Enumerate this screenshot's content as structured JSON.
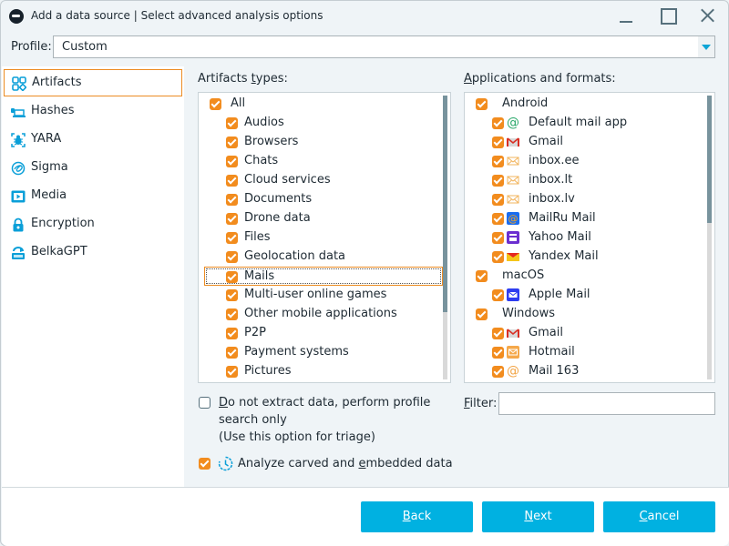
{
  "window": {
    "title": "Add a data source | Select advanced analysis options",
    "minimize_label": "minimize",
    "maximize_label": "maximize",
    "close_label": "close"
  },
  "profile": {
    "label": "Profile:",
    "value": "Custom"
  },
  "sidebar": {
    "items": [
      {
        "label": "Artifacts",
        "icon": "artifacts-icon",
        "active": true
      },
      {
        "label": "Hashes",
        "icon": "hashes-icon",
        "active": false
      },
      {
        "label": "YARA",
        "icon": "yara-bug-icon",
        "active": false
      },
      {
        "label": "Sigma",
        "icon": "sigma-icon",
        "active": false
      },
      {
        "label": "Media",
        "icon": "media-icon",
        "active": false
      },
      {
        "label": "Encryption",
        "icon": "lock-icon",
        "active": false
      },
      {
        "label": "BelkaGPT",
        "icon": "belkagpt-icon",
        "active": false
      }
    ]
  },
  "artifacts": {
    "label_pre": "Artifacts ",
    "label_u": "t",
    "label_post": "ypes:",
    "items": [
      {
        "label": "All",
        "checked": true,
        "level": 0
      },
      {
        "label": "Audios",
        "checked": true,
        "level": 1
      },
      {
        "label": "Browsers",
        "checked": true,
        "level": 1
      },
      {
        "label": "Chats",
        "checked": true,
        "level": 1
      },
      {
        "label": "Cloud services",
        "checked": true,
        "level": 1
      },
      {
        "label": "Documents",
        "checked": true,
        "level": 1
      },
      {
        "label": "Drone data",
        "checked": true,
        "level": 1
      },
      {
        "label": "Files",
        "checked": true,
        "level": 1
      },
      {
        "label": "Geolocation data",
        "checked": true,
        "level": 1
      },
      {
        "label": "Mails",
        "checked": true,
        "level": 1,
        "focused": true
      },
      {
        "label": "Multi-user online games",
        "checked": true,
        "level": 1
      },
      {
        "label": "Other mobile applications",
        "checked": true,
        "level": 1
      },
      {
        "label": "P2P",
        "checked": true,
        "level": 1
      },
      {
        "label": "Payment systems",
        "checked": true,
        "level": 1
      },
      {
        "label": "Pictures",
        "checked": true,
        "level": 1
      }
    ]
  },
  "applications": {
    "label_u": "A",
    "label_post": "pplications and formats:",
    "items": [
      {
        "label": "Android",
        "checked": true,
        "level": 0,
        "icon": ""
      },
      {
        "label": "Default mail app",
        "checked": true,
        "level": 1,
        "icon": "at-sign-green-icon"
      },
      {
        "label": "Gmail",
        "checked": true,
        "level": 1,
        "icon": "gmail-icon"
      },
      {
        "label": "inbox.ee",
        "checked": true,
        "level": 1,
        "icon": "envelope-outline-icon"
      },
      {
        "label": "inbox.lt",
        "checked": true,
        "level": 1,
        "icon": "envelope-outline-icon"
      },
      {
        "label": "inbox.lv",
        "checked": true,
        "level": 1,
        "icon": "envelope-outline-icon"
      },
      {
        "label": "MailRu Mail",
        "checked": true,
        "level": 1,
        "icon": "mailru-icon"
      },
      {
        "label": "Yahoo Mail",
        "checked": true,
        "level": 1,
        "icon": "yahoo-mail-icon"
      },
      {
        "label": "Yandex Mail",
        "checked": true,
        "level": 1,
        "icon": "yandex-mail-icon"
      },
      {
        "label": "macOS",
        "checked": true,
        "level": 0,
        "icon": ""
      },
      {
        "label": "Apple Mail",
        "checked": true,
        "level": 1,
        "icon": "apple-mail-icon"
      },
      {
        "label": "Windows",
        "checked": true,
        "level": 0,
        "icon": ""
      },
      {
        "label": "Gmail",
        "checked": true,
        "level": 1,
        "icon": "gmail-icon"
      },
      {
        "label": "Hotmail",
        "checked": true,
        "level": 1,
        "icon": "hotmail-icon"
      },
      {
        "label": "Mail 163",
        "checked": true,
        "level": 1,
        "icon": "at-sign-orange-icon"
      }
    ]
  },
  "options": {
    "no_extract": {
      "checked": false,
      "u": "D",
      "line1_post": "o not extract data, perform profile",
      "line2": "search only",
      "line3": "(Use this option for triage)"
    },
    "carved": {
      "checked": true,
      "pre": "Analyze carved and ",
      "u": "e",
      "post": "mbedded data"
    }
  },
  "filter": {
    "label_u": "F",
    "label_post": "ilter:",
    "value": ""
  },
  "buttons": {
    "back_u": "B",
    "back_post": "ack",
    "next_u": "N",
    "next_post": "ext",
    "cancel_u": "C",
    "cancel_post": "ancel"
  },
  "colors": {
    "accent": "#00b1e1",
    "checkbox": "#f28c1e",
    "focus": "#ec8c23",
    "scroll_thumb": "#78939d"
  }
}
